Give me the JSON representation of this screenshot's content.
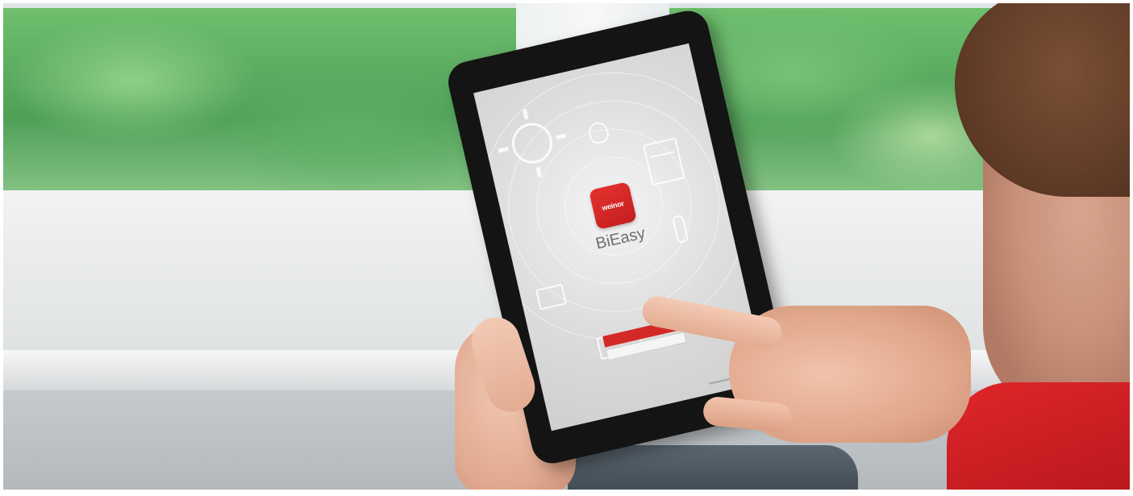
{
  "scene": {
    "description_free": true
  },
  "tablet_app": {
    "icon_label": "weinor",
    "app_name": "BiEasy",
    "login_button_label": "",
    "secondary_button_label": "",
    "accent_color": "#d42a27"
  },
  "icons": [
    "sun-icon",
    "window-icon",
    "bulb-icon",
    "tv-icon",
    "radiator-icon",
    "thermometer-icon"
  ]
}
